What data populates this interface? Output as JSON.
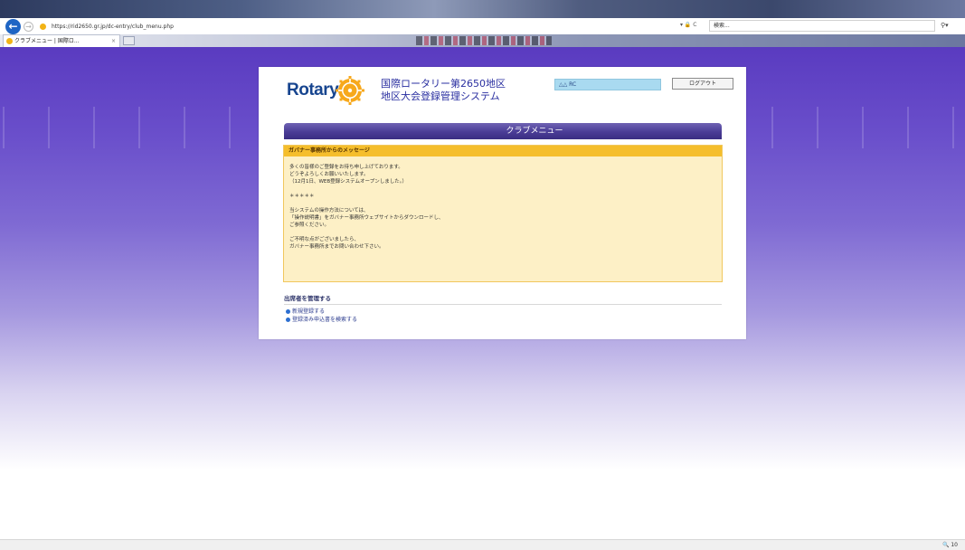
{
  "browser": {
    "url": "https://rid2650.gr.jp/dc-entry/club_menu.php",
    "url_icons": "▾ 🔒 C",
    "search_placeholder": "検索...",
    "search_icon": "search-icon",
    "tab_title": "クラブメニュー | 国際ロ...",
    "tab_close": "×"
  },
  "header": {
    "logo_text": "Rotary",
    "org_line1": "国際ロータリー第2650地区",
    "org_line2": "地区大会登録管理システム",
    "user_name": "△△ RC",
    "logout_label": "ログアウト"
  },
  "menu": {
    "title": "クラブメニュー"
  },
  "message": {
    "title": "ガバナー事務所からのメッセージ",
    "lines": [
      "多くの皆様のご登録をお待ち申し上げております。",
      "どうぞよろしくお願いいたします。",
      "（12月1日、WEB登録システムオープンしました。）",
      "",
      "＊＊＊＊＊",
      "",
      "当システムの操作方法については、",
      "「操作説明書」をガバナー事務所ウェブサイトからダウンロードし、",
      "ご参照ください。",
      "",
      "ご不明な点がございましたら、",
      "ガバナー事務所までお問い合わせ下さい。"
    ]
  },
  "section": {
    "heading": "出席者を管理する",
    "links": [
      "新規登録する",
      "登録済み申込書を検索する"
    ]
  },
  "statusbar": {
    "zoom": "🔍 10"
  },
  "colors": {
    "brand_blue": "#17458f",
    "rotary_gold": "#f7a81b",
    "menu_purple": "#4a3c96",
    "message_bg": "#fdf0c6",
    "message_header": "#f5be2c"
  }
}
